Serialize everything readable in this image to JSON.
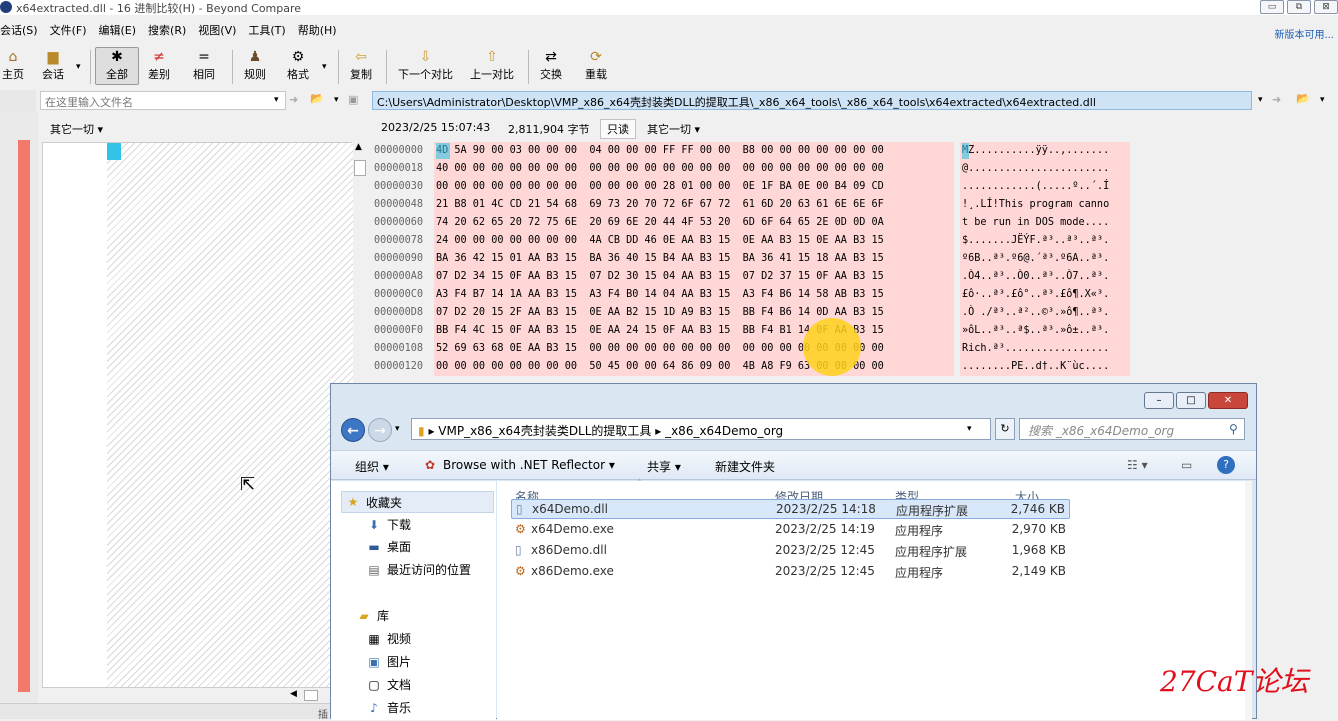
{
  "window": {
    "title": "x64extracted.dll - 16 进制比较(H) - Beyond Compare",
    "controls": [
      "▭",
      "⧉",
      "⊠"
    ]
  },
  "menu": [
    "会话(S)",
    "文件(F)",
    "编辑(E)",
    "搜索(R)",
    "视图(V)",
    "工具(T)",
    "帮助(H)"
  ],
  "new_version": "新版本可用...",
  "toolbar": {
    "home": "主页",
    "session": "会话",
    "all": "全部",
    "diffs": "差别",
    "same": "相同",
    "rules": "规则",
    "format": "格式",
    "copy": "复制",
    "next_diff": "下一个对比",
    "prev_diff": "上一对比",
    "swap": "交换",
    "reload": "重载"
  },
  "left": {
    "placeholder": "在这里输入文件名",
    "misc": "其它一切"
  },
  "right": {
    "path": "C:\\Users\\Administrator\\Desktop\\VMP_x86_x64壳封装类DLL的提取工具\\_x86_x64_tools\\_x86_x64_tools\\x64extracted\\x64extracted.dll",
    "date": "2023/2/25 15:07:43",
    "size": "2,811,904 字节",
    "readonly": "只读",
    "misc": "其它一切"
  },
  "hex_rows": [
    {
      "offset": "00000000",
      "bytes": "4D 5A 90 00 03 00 00 00  04 00 00 00 FF FF 00 00  B8 00 00 00 00 00 00 00",
      "ascii": "MZ..........ÿÿ..,......."
    },
    {
      "offset": "00000018",
      "bytes": "40 00 00 00 00 00 00 00  00 00 00 00 00 00 00 00  00 00 00 00 00 00 00 00",
      "ascii": "@......................."
    },
    {
      "offset": "00000030",
      "bytes": "00 00 00 00 00 00 00 00  00 00 00 00 28 01 00 00  0E 1F BA 0E 00 B4 09 CD",
      "ascii": "............(.....º..´.Í"
    },
    {
      "offset": "00000048",
      "bytes": "21 B8 01 4C CD 21 54 68  69 73 20 70 72 6F 67 72  61 6D 20 63 61 6E 6E 6F",
      "ascii": "!¸.LÍ!This program canno"
    },
    {
      "offset": "00000060",
      "bytes": "74 20 62 65 20 72 75 6E  20 69 6E 20 44 4F 53 20  6D 6F 64 65 2E 0D 0D 0A",
      "ascii": "t be run in DOS mode...."
    },
    {
      "offset": "00000078",
      "bytes": "24 00 00 00 00 00 00 00  4A CB DD 46 0E AA B3 15  0E AA B3 15 0E AA B3 15",
      "ascii": "$.......JËÝF.ª³..ª³..ª³."
    },
    {
      "offset": "00000090",
      "bytes": "BA 36 42 15 01 AA B3 15  BA 36 40 15 B4 AA B3 15  BA 36 41 15 18 AA B3 15",
      "ascii": "º6B..ª³.º6@.´ª³.º6A..ª³."
    },
    {
      "offset": "000000A8",
      "bytes": "07 D2 34 15 0F AA B3 15  07 D2 30 15 04 AA B3 15  07 D2 37 15 0F AA B3 15",
      "ascii": ".Ò4..ª³..Ò0..ª³..Ò7..ª³."
    },
    {
      "offset": "000000C0",
      "bytes": "A3 F4 B7 14 1A AA B3 15  A3 F4 B0 14 04 AA B3 15  A3 F4 B6 14 58 AB B3 15",
      "ascii": "£ô·..ª³.£ô°..ª³.£ô¶.X«³."
    },
    {
      "offset": "000000D8",
      "bytes": "07 D2 20 15 2F AA B3 15  0E AA B2 15 1D A9 B3 15  BB F4 B6 14 0D AA B3 15",
      "ascii": ".Ò ./ª³..ª²..©³.»ô¶..ª³."
    },
    {
      "offset": "000000F0",
      "bytes": "BB F4 4C 15 0F AA B3 15  0E AA 24 15 0F AA B3 15  BB F4 B1 14 0F AA B3 15",
      "ascii": "»ôL..ª³..ª$..ª³.»ô±..ª³."
    },
    {
      "offset": "00000108",
      "bytes": "52 69 63 68 0E AA B3 15  00 00 00 00 00 00 00 00  00 00 00 00 00 00 00 00",
      "ascii": "Rich.ª³................."
    },
    {
      "offset": "00000120",
      "bytes": "00 00 00 00 00 00 00 00  50 45 00 00 64 86 09 00  4B A8 F9 63 00 00 00 00",
      "ascii": "........PE..d†..K¨ùc...."
    }
  ],
  "explorer": {
    "controls": [
      "–",
      "□",
      "✕"
    ],
    "address": "▸ VMP_x86_x64壳封装类DLL的提取工具 ▸ _x86_x64Demo_org",
    "search_placeholder": "搜索 _x86_x64Demo_org",
    "commands": {
      "organize": "组织 ▾",
      "reflector": "Browse with .NET Reflector ▾",
      "share": "共享 ▾",
      "new_folder": "新建文件夹"
    },
    "nav": {
      "favorites": "收藏夹",
      "downloads": "下载",
      "desktop": "桌面",
      "recent": "最近访问的位置",
      "library": "库",
      "videos": "视频",
      "pictures": "图片",
      "documents": "文档",
      "music": "音乐"
    },
    "columns": {
      "name": "名称",
      "date": "修改日期",
      "type": "类型",
      "size": "大小"
    },
    "files": [
      {
        "name": "x64Demo.dll",
        "date": "2023/2/25 14:18",
        "type": "应用程序扩展",
        "size": "2,746 KB"
      },
      {
        "name": "x64Demo.exe",
        "date": "2023/2/25 14:19",
        "type": "应用程序",
        "size": "2,970 KB"
      },
      {
        "name": "x86Demo.dll",
        "date": "2023/2/25 12:45",
        "type": "应用程序扩展",
        "size": "1,968 KB"
      },
      {
        "name": "x86Demo.exe",
        "date": "2023/2/25 12:45",
        "type": "应用程序",
        "size": "2,149 KB"
      }
    ]
  },
  "watermark": "27CaT论坛",
  "colors": {
    "diff_bg": "#ffd7d7",
    "left_bar": "#f3796a",
    "cursor_highlight": "#ffd21c",
    "watermark": "#e0101c"
  }
}
